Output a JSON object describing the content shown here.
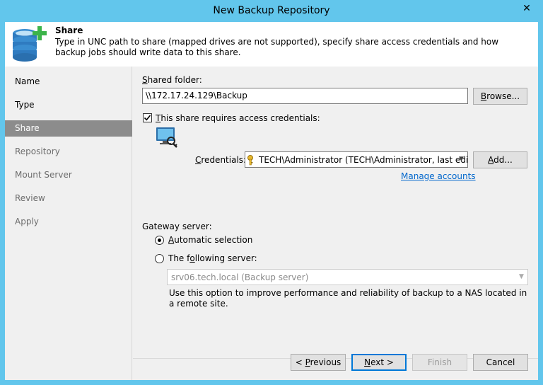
{
  "window": {
    "title": "New Backup Repository",
    "close_glyph": "✕"
  },
  "header": {
    "title": "Share",
    "description": "Type in UNC path to share (mapped drives are not supported), specify share access credentials and how backup jobs should write data to this share.",
    "icon": "database-add-icon"
  },
  "steps": [
    {
      "label": "Name",
      "state": "done"
    },
    {
      "label": "Type",
      "state": "done"
    },
    {
      "label": "Share",
      "state": "active"
    },
    {
      "label": "Repository",
      "state": "disabled"
    },
    {
      "label": "Mount Server",
      "state": "disabled"
    },
    {
      "label": "Review",
      "state": "disabled"
    },
    {
      "label": "Apply",
      "state": "disabled"
    }
  ],
  "share": {
    "shared_folder_label": "Shared folder:",
    "shared_folder_label_u": "S",
    "shared_folder_label_rest": "hared folder:",
    "shared_folder_value": "\\\\172.17.24.129\\Backup",
    "browse_label": "Browse...",
    "browse_label_u": "B",
    "browse_label_rest": "rowse...",
    "requires_credentials_u": "T",
    "requires_credentials_rest": "his share requires access credentials:",
    "requires_credentials_checked": true,
    "credentials_label_u": "C",
    "credentials_label_rest": "redentials:",
    "credentials_value": "TECH\\Administrator (TECH\\Administrator, last edite",
    "add_label_u": "A",
    "add_label_rest": "dd...",
    "manage_accounts": "Manage accounts"
  },
  "gateway": {
    "label": "Gateway server:",
    "automatic_u": "A",
    "automatic_rest": "utomatic selection",
    "automatic_selected": true,
    "following_pre": "The f",
    "following_u": "o",
    "following_rest": "llowing server:",
    "server_value": "srv06.tech.local (Backup server)",
    "hint": "Use this option to improve performance and reliability of backup to a NAS located in a remote site."
  },
  "footer": {
    "previous_pre": "< ",
    "previous_u": "P",
    "previous_rest": "revious",
    "next_u": "N",
    "next_rest": "ext >",
    "finish": "Finish",
    "cancel": "Cancel"
  },
  "colors": {
    "title_bar": "#62c6ec",
    "active_step": "#8c8c8c",
    "link": "#0066cc",
    "icon_accent": "#3cb44a"
  }
}
